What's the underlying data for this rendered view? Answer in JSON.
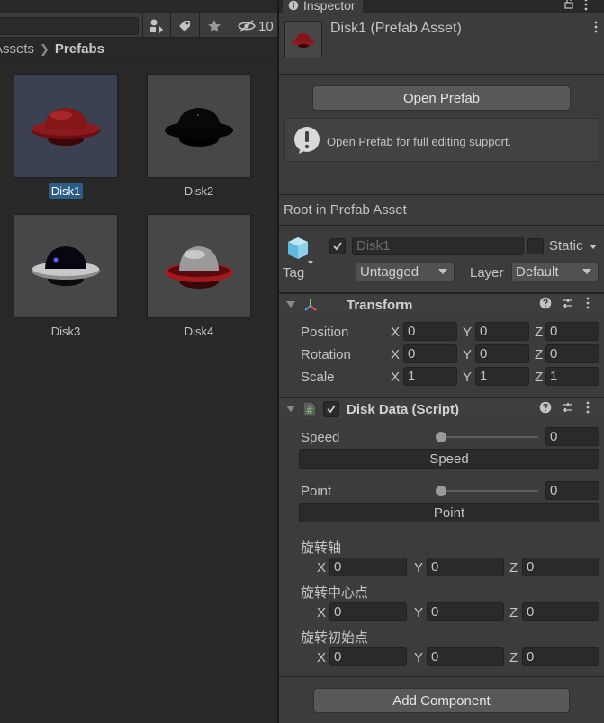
{
  "project": {
    "breadcrumb": [
      "Assets",
      "Prefabs"
    ],
    "hidden_count": "10",
    "assets": [
      {
        "name": "Disk1",
        "selected": true
      },
      {
        "name": "Disk2",
        "selected": false
      },
      {
        "name": "Disk3",
        "selected": false
      },
      {
        "name": "Disk4",
        "selected": false
      }
    ]
  },
  "inspector": {
    "tab_label": "Inspector",
    "header_title": "Disk1 (Prefab Asset)",
    "open_prefab_label": "Open Prefab",
    "help_text": "Open Prefab for full editing support.",
    "root_label": "Root in Prefab Asset",
    "gameobject": {
      "name": "Disk1",
      "static_label": "Static",
      "tag_label": "Tag",
      "tag_value": "Untagged",
      "layer_label": "Layer",
      "layer_value": "Default"
    },
    "transform": {
      "title": "Transform",
      "position_label": "Position",
      "rotation_label": "Rotation",
      "scale_label": "Scale",
      "position": {
        "x": "0",
        "y": "0",
        "z": "0"
      },
      "rotation": {
        "x": "0",
        "y": "0",
        "z": "0"
      },
      "scale": {
        "x": "1",
        "y": "1",
        "z": "1"
      }
    },
    "disk_data": {
      "title": "Disk Data (Script)",
      "speed_label": "Speed",
      "speed_value": "0",
      "speed_button": "Speed",
      "point_label": "Point",
      "point_value": "0",
      "point_button": "Point",
      "axis_label": "旋转轴",
      "axis": {
        "x": "0",
        "y": "0",
        "z": "0"
      },
      "center_label": "旋转中心点",
      "center": {
        "x": "0",
        "y": "0",
        "z": "0"
      },
      "start_label": "旋转初始点",
      "start": {
        "x": "0",
        "y": "0",
        "z": "0"
      }
    },
    "add_component_label": "Add Component"
  },
  "axis_letters": {
    "x": "X",
    "y": "Y",
    "z": "Z"
  },
  "colors": {
    "selection": "#2c5d87",
    "panel_bg": "#3c3c3c",
    "project_bg": "#282828",
    "disk_red": "#7a1316",
    "disk_dark": "#0a0a0a"
  }
}
